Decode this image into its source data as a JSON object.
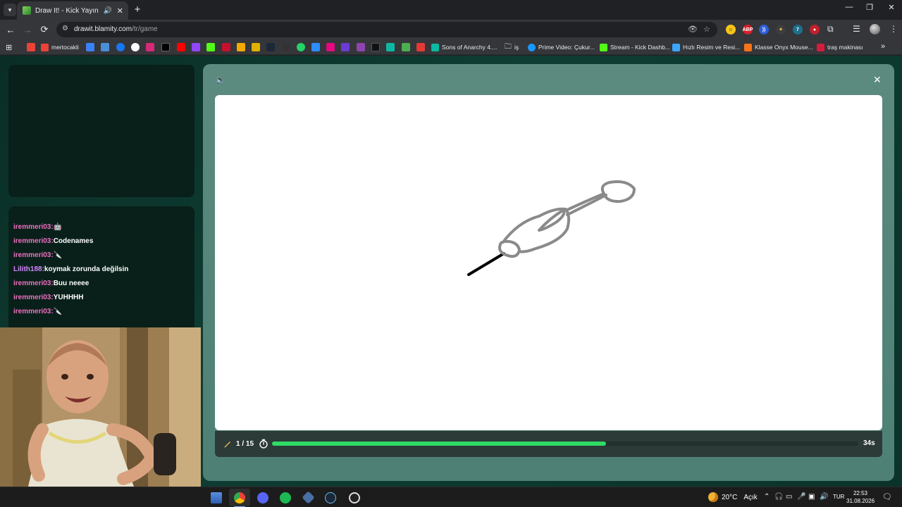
{
  "browser": {
    "tab": {
      "title": "Draw It! - Kick Yayınları İçin",
      "audio_icon": "speaker-icon",
      "close_label": "✕"
    },
    "new_tab_label": "+",
    "url": {
      "host": "drawit.blamity.com",
      "path": "/tr/game"
    },
    "window_controls": {
      "minimize": "—",
      "restore": "❐",
      "close": "✕"
    }
  },
  "bookmarks": {
    "items": [
      {
        "label": "mertocakli",
        "color": "#ea4335"
      },
      {
        "label": "Sons of Anarchy 4....",
        "color": "#0db8a2"
      },
      {
        "label": "iş",
        "color": "#e8eaed"
      },
      {
        "label": "Prime Video: Çukur...",
        "color": "#1a98ff"
      },
      {
        "label": "Stream - Kick Dashb...",
        "color": "#53fc18"
      },
      {
        "label": "Hızlı Resim ve Resi...",
        "color": "#3aa7ff"
      },
      {
        "label": "Klasse Onyx Mouse...",
        "color": "#f97316"
      },
      {
        "label": "traş makinası",
        "color": "#d81b3c"
      }
    ],
    "more_label": "»"
  },
  "chat": {
    "messages": [
      {
        "user": "iremmeri03:",
        "text": "🤖"
      },
      {
        "user": "iremmeri03:",
        "text": "Codenames"
      },
      {
        "user": "iremmeri03:",
        "text": "🔪"
      },
      {
        "user": "Lilith188:",
        "text": "koymak zorunda değilsin"
      },
      {
        "user": "iremmeri03:",
        "text": "Buu neeee"
      },
      {
        "user": "iremmeri03:",
        "text": "YUHHHH"
      },
      {
        "user": "iremmeri03:",
        "text": "🔪"
      }
    ]
  },
  "game": {
    "round_label": "1 / 15",
    "time_remaining_label": "34s",
    "timer_progress": 0.57,
    "sound_icon": "speaker-icon",
    "close_label": "✕",
    "colors": {
      "progress_fill": "#2fdb64",
      "stroke_gray": "#8a8a8a",
      "stroke_black": "#000000"
    }
  },
  "taskbar": {
    "weather": {
      "temperature": "20°C",
      "condition": "Açık"
    },
    "language": "TUR",
    "time": "22:53",
    "date": "31.08.2026"
  }
}
